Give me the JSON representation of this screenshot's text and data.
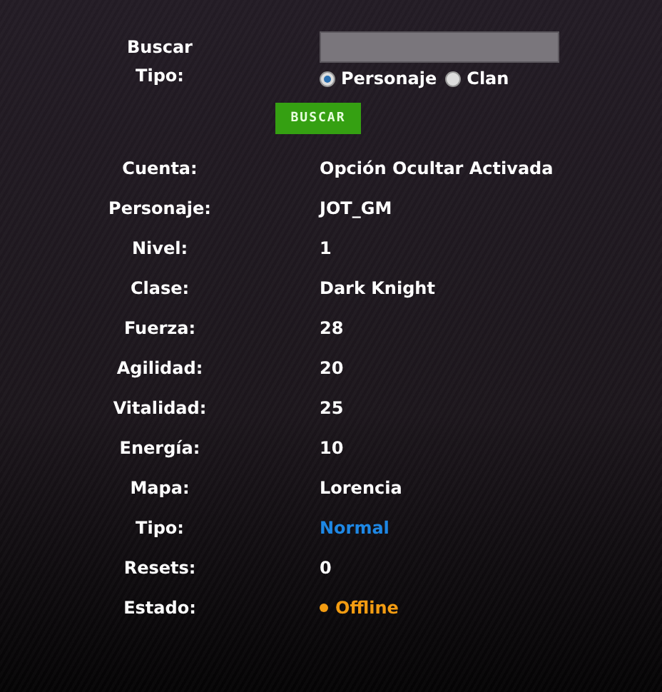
{
  "search": {
    "label": "Buscar",
    "type_label": "Tipo:",
    "options": [
      {
        "label": "Personaje",
        "selected": true
      },
      {
        "label": "Clan",
        "selected": false
      }
    ],
    "button": "BUSCAR"
  },
  "stats": [
    {
      "label": "Cuenta:",
      "value": "Opción Ocultar Activada"
    },
    {
      "label": "Personaje:",
      "value": "JOT_GM"
    },
    {
      "label": "Nivel:",
      "value": "1"
    },
    {
      "label": "Clase:",
      "value": "Dark Knight"
    },
    {
      "label": "Fuerza:",
      "value": "28"
    },
    {
      "label": "Agilidad:",
      "value": "20"
    },
    {
      "label": "Vitalidad:",
      "value": "25"
    },
    {
      "label": "Energía:",
      "value": "10"
    },
    {
      "label": "Mapa:",
      "value": "Lorencia"
    },
    {
      "label": "Tipo:",
      "value": "Normal",
      "color": "#1e88e5"
    },
    {
      "label": "Resets:",
      "value": "0"
    },
    {
      "label": "Estado:",
      "value": "Offline",
      "kind": "status",
      "color": "#f39c12"
    }
  ]
}
